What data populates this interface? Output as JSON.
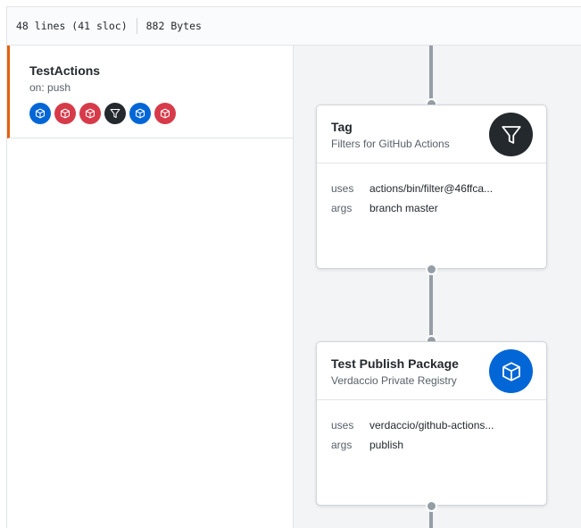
{
  "file_info": {
    "lines": "48 lines (41 sloc)",
    "size": "882 Bytes"
  },
  "workflow": {
    "name": "TestActions",
    "trigger": "on: push",
    "action_icons": [
      {
        "icon": "package-icon",
        "color": "#0366d6"
      },
      {
        "icon": "package-icon",
        "color": "#d73a49"
      },
      {
        "icon": "package-icon",
        "color": "#d73a49"
      },
      {
        "icon": "filter-icon",
        "color": "#24292e"
      },
      {
        "icon": "package-icon",
        "color": "#0366d6"
      },
      {
        "icon": "package-icon",
        "color": "#d73a49"
      }
    ]
  },
  "nodes": [
    {
      "title": "Tag",
      "subtitle": "Filters for GitHub Actions",
      "icon": "filter-icon",
      "icon_color": "#24292e",
      "uses_label": "uses",
      "uses_value": "actions/bin/filter@46ffca...",
      "args_label": "args",
      "args_value": "branch master"
    },
    {
      "title": "Test Publish Package",
      "subtitle": "Verdaccio Private Registry",
      "icon": "package-icon",
      "icon_color": "#0366d6",
      "uses_label": "uses",
      "uses_value": "verdaccio/github-actions...",
      "args_label": "args",
      "args_value": "publish"
    }
  ]
}
